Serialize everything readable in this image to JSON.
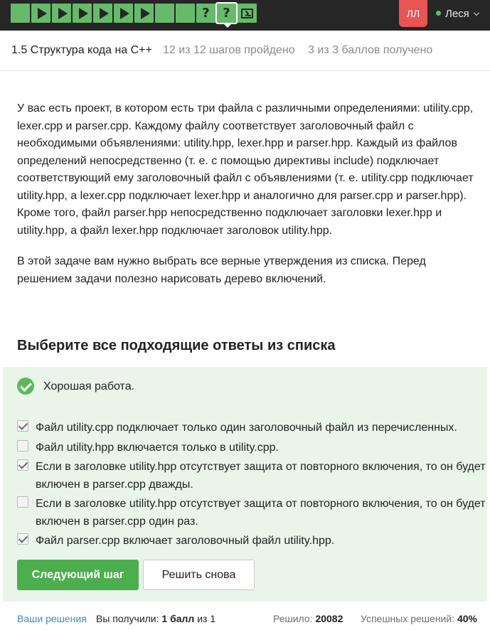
{
  "header": {
    "steps": [
      {
        "kind": "done"
      },
      {
        "kind": "video"
      },
      {
        "kind": "video"
      },
      {
        "kind": "video"
      },
      {
        "kind": "video"
      },
      {
        "kind": "video"
      },
      {
        "kind": "video"
      },
      {
        "kind": "done"
      },
      {
        "kind": "done"
      },
      {
        "kind": "quiz"
      },
      {
        "kind": "quiz",
        "current": true
      },
      {
        "kind": "code"
      }
    ],
    "user": {
      "initials": "ЛЛ",
      "name": "Леся"
    },
    "colors": {
      "bar": "#262626",
      "step": "#66bb6a",
      "avatar": "#e95454"
    }
  },
  "lesson": {
    "title": "1.5 Структура кода на C++",
    "steps_progress": "12 из 12 шагов пройдено",
    "score": "3 из 3 баллов  получено"
  },
  "content": {
    "paragraph1": "У вас есть проект, в котором есть три файла с различными определениями: utility.cpp, lexer.cpp и parser.cpp. Каждому файлу соответствует заголовочный файл с необходимыми объявлениями: utility.hpp, lexer.hpp и parser.hpp. Каждый из файлов определений непосредственно (т. е. с помощью директивы include) подключает соответствующий ему заголовочный файл с объявлениями (т. е. utility.cpp подключает utility.hpp, а lexer.cpp подключает lexer.hpp и аналогично для parser.cpp и parser.hpp). Кроме того, файл parser.hpp непосредственно подключает заголовки lexer.hpp и utility.hpp, а файл lexer.hpp подключает заголовок utility.hpp.",
    "paragraph2": "В этой задаче вам нужно выбрать все верные утверждения из списка. Перед решением задачи полезно нарисовать дерево включений."
  },
  "quiz": {
    "title": "Выберите все подходящие ответы из списка",
    "feedback": "Хорошая работа.",
    "options": [
      {
        "label": "Файл utility.cpp подключает только один заголовочный файл из перечисленных.",
        "checked": true
      },
      {
        "label": "Файл utility.hpp включается только в utility.cpp.",
        "checked": false
      },
      {
        "label": "Если в заголовке utility.hpp отсутствует защита от повторного включения, то он будет включен в parser.cpp дважды.",
        "checked": true
      },
      {
        "label": "Если в заголовке utility.hpp отсутствует защита от повторного включения, то он будет включен в parser.cpp один раз.",
        "checked": false
      },
      {
        "label": "Файл parser.cpp включает заголовочный файл utility.hpp.",
        "checked": true
      }
    ],
    "next_button": "Следующий шаг",
    "retry_button": "Решить снова",
    "colors": {
      "panel": "#e9f5e8",
      "success": "#4cae4c"
    }
  },
  "footer": {
    "solutions_link": "Ваши решения",
    "got_label": "Вы получили: ",
    "got_value": "1 балл",
    "got_suffix": " из 1",
    "solved_label": "Решило: ",
    "solved_value": "20082",
    "success_label": "Успешных решений: ",
    "success_value": "40%"
  }
}
